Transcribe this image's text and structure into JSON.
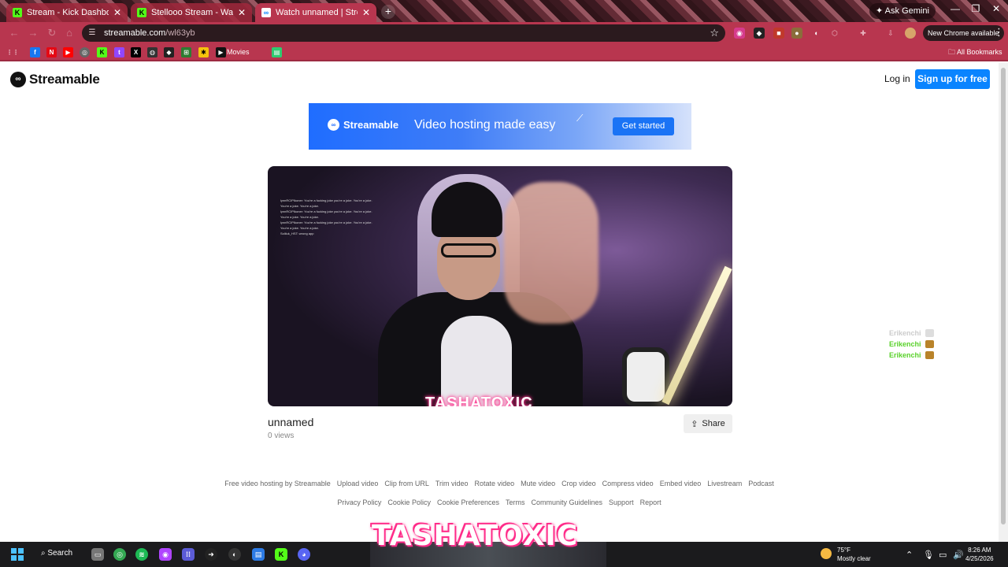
{
  "browser": {
    "tabs": [
      {
        "title": "Stream - Kick Dashboard",
        "icon": "kick-icon",
        "color": "#53fc18"
      },
      {
        "title": "Stellooo Stream - Watch Live on Kick",
        "icon": "kick-icon",
        "color": "#53fc18"
      },
      {
        "title": "Watch unnamed | Streamable",
        "icon": "streamable-icon",
        "color": "#0a84ff"
      }
    ],
    "gemini_label": "Ask Gemini",
    "url_host": "streamable.com",
    "url_path": "/wl63yb",
    "new_chrome_label": "New Chrome available",
    "bookmarks": {
      "movies_label": "Movies",
      "all_bookmarks_label": "All Bookmarks"
    }
  },
  "site": {
    "logo_text": "Streamable",
    "login_label": "Log in",
    "signup_label": "Sign up for free",
    "banner": {
      "logo_text": "Streamable",
      "tagline": "Video hosting made easy",
      "cta": "Get started"
    },
    "video": {
      "title": "unnamed",
      "views": "0 views",
      "overlay_name": "TASHATOXIC",
      "chat_lines": [
        "lynnRCIPIkoner: You're a fucking joke you're a joke. You're a joke.",
        "You're a joke. You're a joke.",
        "lynnRCIPIkoner: You're a fucking joke you're a joke. You're a joke.",
        "You're a joke. You're a joke.",
        "lynnRCIPIkoner: You're a fucking joke you're a joke. You're a joke.",
        "You're a joke. You're a joke.",
        "Soliluk_HST: wrong app"
      ]
    },
    "share_label": "Share",
    "footer_row1": [
      "Free video hosting by Streamable",
      "Upload video",
      "Clip from URL",
      "Trim video",
      "Rotate video",
      "Mute video",
      "Crop video",
      "Compress video",
      "Embed video",
      "Livestream",
      "Podcast"
    ],
    "footer_row2": [
      "Privacy Policy",
      "Cookie Policy",
      "Cookie Preferences",
      "Terms",
      "Community Guidelines",
      "Support",
      "Report"
    ]
  },
  "side_chat": [
    {
      "name": "Erikenchi",
      "color": "#cccccc"
    },
    {
      "name": "Erikenchi",
      "color": "#59d12a"
    },
    {
      "name": "Erikenchi",
      "color": "#59d12a"
    }
  ],
  "stream_overlay": "TASHATOXIC",
  "taskbar": {
    "search_label": "Search",
    "weather_temp": "75°F",
    "weather_desc": "Mostly clear",
    "time": "8:26 AM",
    "date": "4/25/2026"
  },
  "colors": {
    "chrome_toolbar": "#b8364f",
    "accent_blue": "#0a84ff",
    "kick_green": "#53fc18"
  }
}
